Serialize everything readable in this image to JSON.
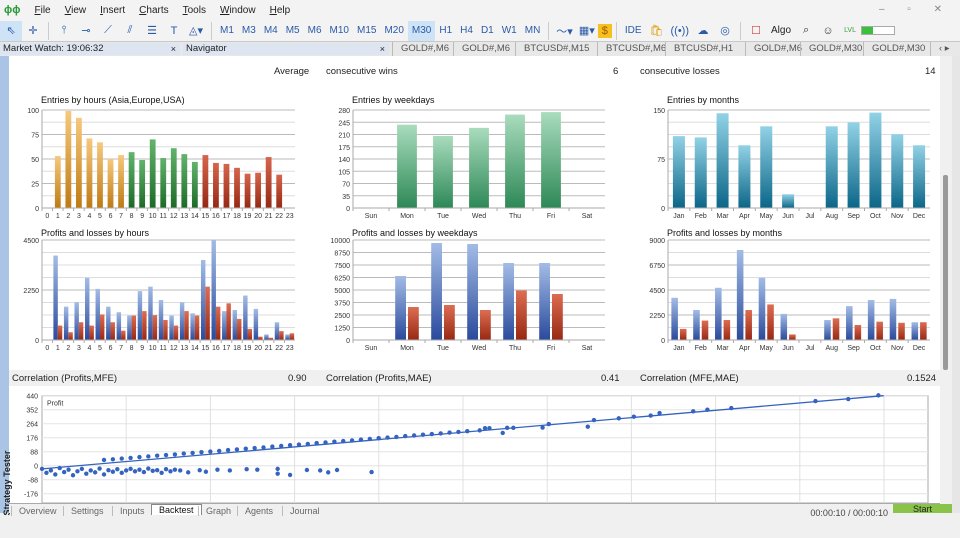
{
  "menu": {
    "items": [
      "File",
      "View",
      "Insert",
      "Charts",
      "Tools",
      "Window",
      "Help"
    ]
  },
  "toolbar": {
    "timeframes": [
      "M1",
      "M3",
      "M4",
      "M5",
      "M6",
      "M10",
      "M15",
      "M20",
      "M30",
      "H1",
      "H4",
      "D1",
      "W1",
      "MN"
    ],
    "selected_timeframe": "M30",
    "ide_label": "IDE",
    "algo_label": "Algo",
    "lvl_label": "LVL"
  },
  "panels": {
    "market_watch": "Market Watch: 19:06:32",
    "navigator": "Navigator"
  },
  "chart_tabs": [
    "GOLD#,M6",
    "GOLD#,M6",
    "BTCUSD#,M15",
    "BTCUSD#,M6",
    "BTCUSD#,H1",
    "GOLD#,M6",
    "GOLD#,M30",
    "GOLD#,M30"
  ],
  "stats": {
    "label": "Average",
    "wins_label": "consecutive wins",
    "wins_value": "6",
    "losses_label": "consecutive losses",
    "losses_value": "14"
  },
  "correlation": [
    {
      "label": "Correlation (Profits,MFE)",
      "value": "0.90"
    },
    {
      "label": "Correlation (Profits,MAE)",
      "value": "0.41"
    },
    {
      "label": "Correlation (MFE,MAE)",
      "value": "0.1524"
    }
  ],
  "colors": {
    "asia": "#d08a20",
    "europe": "#2f8a3a",
    "usa": "#b03a22",
    "profit": "#3a5ca8",
    "loss": "#a8341e",
    "weekday": "#3a9a66",
    "month": "#1a7e9e",
    "scatter": "#3563c0"
  },
  "chart_data": [
    {
      "id": "hours",
      "type": "bar",
      "title": "Entries by hours (Asia,Europe,USA)",
      "categories": [
        "0",
        "1",
        "2",
        "3",
        "4",
        "5",
        "6",
        "7",
        "8",
        "9",
        "10",
        "11",
        "12",
        "13",
        "14",
        "15",
        "16",
        "17",
        "18",
        "19",
        "20",
        "21",
        "22",
        "23"
      ],
      "values": [
        0,
        53,
        99,
        92,
        71,
        67,
        50,
        54,
        57,
        49,
        70,
        51,
        61,
        55,
        47,
        54,
        46,
        45,
        41,
        35,
        36,
        52,
        34,
        0
      ],
      "sessions": [
        "asia",
        "asia",
        "asia",
        "asia",
        "asia",
        "asia",
        "asia",
        "asia",
        "europe",
        "europe",
        "europe",
        "europe",
        "europe",
        "europe",
        "europe",
        "usa",
        "usa",
        "usa",
        "usa",
        "usa",
        "usa",
        "usa",
        "usa",
        "usa"
      ],
      "yticks": [
        0,
        25,
        50,
        75,
        100
      ],
      "ylim": [
        0,
        100
      ],
      "grid": true
    },
    {
      "id": "weekdays",
      "type": "bar",
      "title": "Entries by weekdays",
      "categories": [
        "Sun",
        "Mon",
        "Tue",
        "Wed",
        "Thu",
        "Fri",
        "Sat"
      ],
      "values": [
        0,
        238,
        206,
        229,
        267,
        274,
        0
      ],
      "yticks": [
        0,
        35,
        70,
        105,
        140,
        175,
        210,
        245,
        280
      ],
      "ylim": [
        0,
        280
      ],
      "grid": true
    },
    {
      "id": "months",
      "type": "bar",
      "title": "Entries by months",
      "categories": [
        "Jan",
        "Feb",
        "Mar",
        "Apr",
        "May",
        "Jun",
        "Jul",
        "Aug",
        "Sep",
        "Oct",
        "Nov",
        "Dec"
      ],
      "values": [
        110,
        108,
        145,
        96,
        125,
        21,
        0,
        125,
        131,
        146,
        113,
        96
      ],
      "yticks": [
        0,
        75,
        150
      ],
      "ylim": [
        0,
        150
      ],
      "grid": true
    },
    {
      "id": "pl_hours",
      "type": "bar",
      "title": "Profits and losses by hours",
      "categories": [
        "0",
        "1",
        "2",
        "3",
        "4",
        "5",
        "6",
        "7",
        "8",
        "9",
        "10",
        "11",
        "12",
        "13",
        "14",
        "15",
        "16",
        "17",
        "18",
        "19",
        "20",
        "21",
        "22",
        "23"
      ],
      "series": [
        {
          "key": "profit",
          "values": [
            0,
            3800,
            1500,
            1700,
            2800,
            2300,
            1500,
            1250,
            1100,
            2200,
            2400,
            1800,
            1100,
            1700,
            1200,
            3600,
            4500,
            1300,
            1350,
            2000,
            1400,
            250,
            800,
            250
          ]
        },
        {
          "key": "loss",
          "values": [
            0,
            650,
            350,
            800,
            650,
            1150,
            800,
            420,
            1100,
            1300,
            1120,
            900,
            650,
            1300,
            1100,
            2400,
            1500,
            1650,
            950,
            500,
            150,
            100,
            400,
            300
          ]
        }
      ],
      "yticks": [
        0,
        2250,
        4500
      ],
      "ylim": [
        0,
        4500
      ],
      "grid": true
    },
    {
      "id": "pl_weekdays",
      "type": "bar",
      "title": "Profits and losses by weekdays",
      "categories": [
        "Sun",
        "Mon",
        "Tue",
        "Wed",
        "Thu",
        "Fri",
        "Sat"
      ],
      "series": [
        {
          "key": "profit",
          "values": [
            0,
            6400,
            9700,
            9600,
            7700,
            7700,
            0
          ]
        },
        {
          "key": "loss",
          "values": [
            0,
            3300,
            3500,
            3000,
            4950,
            4600,
            0
          ]
        }
      ],
      "yticks": [
        0,
        1250,
        2500,
        3750,
        5000,
        6250,
        7500,
        8750,
        10000
      ],
      "ylim": [
        0,
        10000
      ],
      "grid": true
    },
    {
      "id": "pl_months",
      "type": "bar",
      "title": "Profits and losses by months",
      "categories": [
        "Jan",
        "Feb",
        "Mar",
        "Apr",
        "May",
        "Jun",
        "Jul",
        "Aug",
        "Sep",
        "Oct",
        "Nov",
        "Dec"
      ],
      "series": [
        {
          "key": "profit",
          "values": [
            3800,
            2700,
            4700,
            8100,
            5600,
            2350,
            0,
            1800,
            3050,
            3600,
            3700,
            1600
          ]
        },
        {
          "key": "loss",
          "values": [
            1000,
            1750,
            1800,
            2700,
            3200,
            500,
            0,
            1950,
            1350,
            1650,
            1550,
            1600
          ]
        }
      ],
      "yticks": [
        0,
        2250,
        4500,
        6750,
        9000
      ],
      "ylim": [
        0,
        9000
      ],
      "grid": true
    },
    {
      "id": "scatter",
      "type": "scatter",
      "title": "Profit",
      "yticks": [
        -176,
        -88,
        0,
        88,
        176,
        264,
        352,
        440
      ],
      "ylim": [
        -250,
        440
      ],
      "xlim": [
        0,
        100
      ],
      "grid": true,
      "trend": [
        [
          0,
          -20
        ],
        [
          95,
          440
        ]
      ],
      "points": [
        [
          7,
          36
        ],
        [
          8,
          40
        ],
        [
          9,
          45
        ],
        [
          10,
          49
        ],
        [
          11,
          54
        ],
        [
          12,
          58
        ],
        [
          13,
          63
        ],
        [
          14,
          67
        ],
        [
          15,
          71
        ],
        [
          16,
          76
        ],
        [
          17,
          80
        ],
        [
          18,
          85
        ],
        [
          19,
          89
        ],
        [
          20,
          93
        ],
        [
          21,
          98
        ],
        [
          22,
          102
        ],
        [
          23,
          107
        ],
        [
          24,
          111
        ],
        [
          25,
          115
        ],
        [
          26,
          120
        ],
        [
          27,
          124
        ],
        [
          28,
          129
        ],
        [
          29,
          133
        ],
        [
          30,
          137
        ],
        [
          31,
          142
        ],
        [
          32,
          146
        ],
        [
          33,
          151
        ],
        [
          34,
          155
        ],
        [
          35,
          159
        ],
        [
          36,
          164
        ],
        [
          37,
          168
        ],
        [
          38,
          173
        ],
        [
          39,
          177
        ],
        [
          40,
          181
        ],
        [
          41,
          186
        ],
        [
          42,
          190
        ],
        [
          43,
          195
        ],
        [
          44,
          199
        ],
        [
          45,
          203
        ],
        [
          46,
          208
        ],
        [
          47,
          212
        ],
        [
          48,
          217
        ],
        [
          50,
          236
        ],
        [
          50.5,
          236
        ],
        [
          52.5,
          238
        ],
        [
          53.2,
          238
        ],
        [
          56.5,
          240
        ],
        [
          57.2,
          262
        ],
        [
          61.6,
          245
        ],
        [
          62.3,
          287
        ],
        [
          65.1,
          298
        ],
        [
          66.8,
          308
        ],
        [
          68.7,
          315
        ],
        [
          69.7,
          331
        ],
        [
          73.5,
          342
        ],
        [
          75.1,
          352
        ],
        [
          77.8,
          362
        ],
        [
          87.3,
          406
        ],
        [
          91,
          419
        ],
        [
          94.4,
          442
        ],
        [
          49.4,
          222
        ],
        [
          52,
          206
        ],
        [
          0,
          -20
        ],
        [
          0.5,
          -45
        ],
        [
          1,
          -30
        ],
        [
          1.5,
          -55
        ],
        [
          2,
          -15
        ],
        [
          2.5,
          -40
        ],
        [
          3,
          -25
        ],
        [
          3.5,
          -60
        ],
        [
          4,
          -35
        ],
        [
          4.5,
          -20
        ],
        [
          5,
          -50
        ],
        [
          5.5,
          -30
        ],
        [
          6,
          -42
        ],
        [
          6.5,
          -18
        ],
        [
          7,
          -55
        ],
        [
          7.5,
          -28
        ],
        [
          8,
          -38
        ],
        [
          8.5,
          -22
        ],
        [
          9,
          -45
        ],
        [
          9.5,
          -30
        ],
        [
          10,
          -20
        ],
        [
          10.5,
          -35
        ],
        [
          11,
          -25
        ],
        [
          11.5,
          -40
        ],
        [
          12,
          -18
        ],
        [
          12.5,
          -32
        ],
        [
          13,
          -28
        ],
        [
          13.5,
          -45
        ],
        [
          14,
          -22
        ],
        [
          14.5,
          -35
        ],
        [
          15,
          -25
        ],
        [
          15.6,
          -30
        ],
        [
          16.5,
          -42
        ],
        [
          17.8,
          -28
        ],
        [
          18.5,
          -38
        ],
        [
          19.8,
          -25
        ],
        [
          21.2,
          -30
        ],
        [
          23.1,
          -22
        ],
        [
          24.3,
          -25
        ],
        [
          26.6,
          -20
        ],
        [
          26.6,
          -50
        ],
        [
          28,
          -58
        ],
        [
          29.9,
          -27
        ],
        [
          31.4,
          -30
        ],
        [
          32.3,
          -42
        ],
        [
          33.3,
          -27
        ],
        [
          37.2,
          -40
        ]
      ]
    }
  ],
  "tester": {
    "side_label": "Strategy Tester",
    "tabs": [
      "Overview",
      "Settings",
      "Inputs",
      "Backtest",
      "Graph",
      "Agents",
      "Journal"
    ],
    "active_tab": "Backtest",
    "timer": "00:00:10 / 00:00:10",
    "start_label": "Start"
  }
}
